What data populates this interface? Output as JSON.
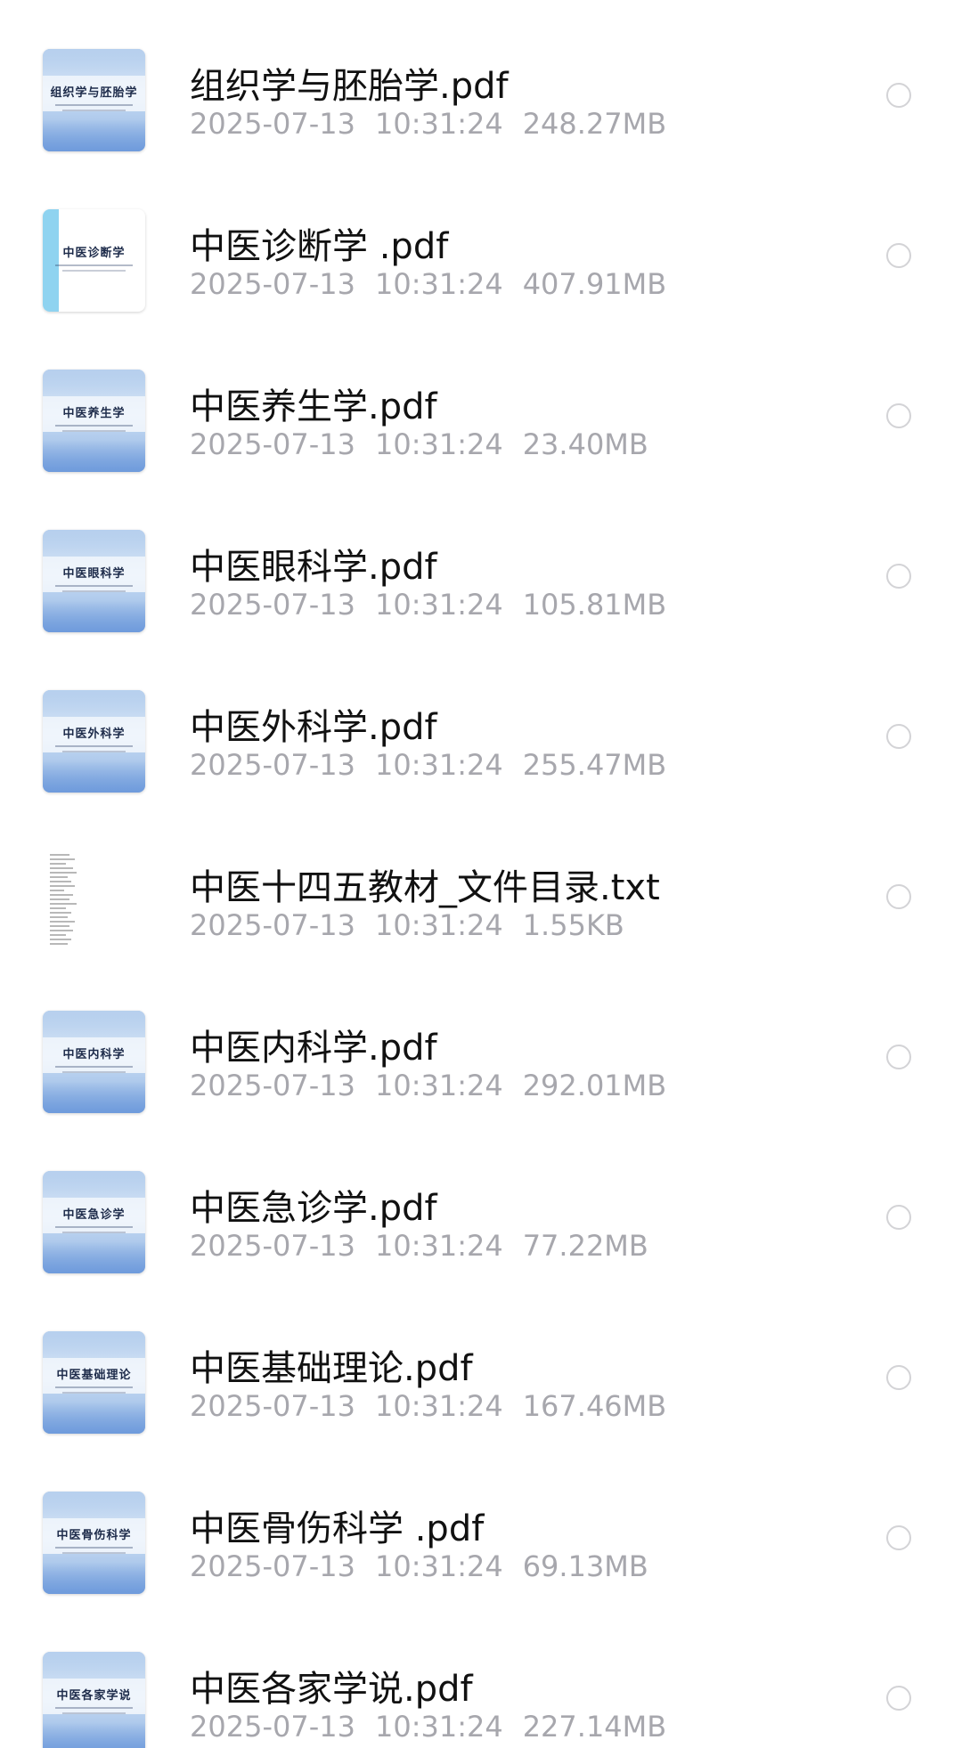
{
  "files": [
    {
      "name": "组织学与胚胎学.pdf",
      "date": "2025-07-13",
      "time": "10:31:24",
      "size": "248.27MB",
      "cover_title": "组织学与胚胎学",
      "icon": "pdf-cover-icon"
    },
    {
      "name": "中医诊断学  .pdf",
      "date": "2025-07-13",
      "time": "10:31:24",
      "size": "407.91MB",
      "cover_title": "中医诊断学",
      "icon": "pdf-cover-icon"
    },
    {
      "name": "中医养生学.pdf",
      "date": "2025-07-13",
      "time": "10:31:24",
      "size": "23.40MB",
      "cover_title": "中医养生学",
      "icon": "pdf-cover-icon"
    },
    {
      "name": "中医眼科学.pdf",
      "date": "2025-07-13",
      "time": "10:31:24",
      "size": "105.81MB",
      "cover_title": "中医眼科学",
      "icon": "pdf-cover-icon"
    },
    {
      "name": "中医外科学.pdf",
      "date": "2025-07-13",
      "time": "10:31:24",
      "size": "255.47MB",
      "cover_title": "中医外科学",
      "icon": "pdf-cover-icon"
    },
    {
      "name": "中医十四五教材_文件目录.txt",
      "date": "2025-07-13",
      "time": "10:31:24",
      "size": "1.55KB",
      "cover_title": "",
      "icon": "txt-file-icon"
    },
    {
      "name": "中医内科学.pdf",
      "date": "2025-07-13",
      "time": "10:31:24",
      "size": "292.01MB",
      "cover_title": "中医内科学",
      "icon": "pdf-cover-icon"
    },
    {
      "name": "中医急诊学.pdf",
      "date": "2025-07-13",
      "time": "10:31:24",
      "size": "77.22MB",
      "cover_title": "中医急诊学",
      "icon": "pdf-cover-icon"
    },
    {
      "name": "中医基础理论.pdf",
      "date": "2025-07-13",
      "time": "10:31:24",
      "size": "167.46MB",
      "cover_title": "中医基础理论",
      "icon": "pdf-cover-icon"
    },
    {
      "name": "中医骨伤科学 .pdf",
      "date": "2025-07-13",
      "time": "10:31:24",
      "size": "69.13MB",
      "cover_title": "中医骨伤科学",
      "icon": "pdf-cover-icon"
    },
    {
      "name": "中医各家学说.pdf",
      "date": "2025-07-13",
      "time": "10:31:24",
      "size": "227.14MB",
      "cover_title": "中医各家学说",
      "icon": "pdf-cover-icon"
    }
  ],
  "colors": {
    "name": "#111111",
    "meta": "#a7a7ad",
    "radio_border": "#d3d3d6"
  }
}
